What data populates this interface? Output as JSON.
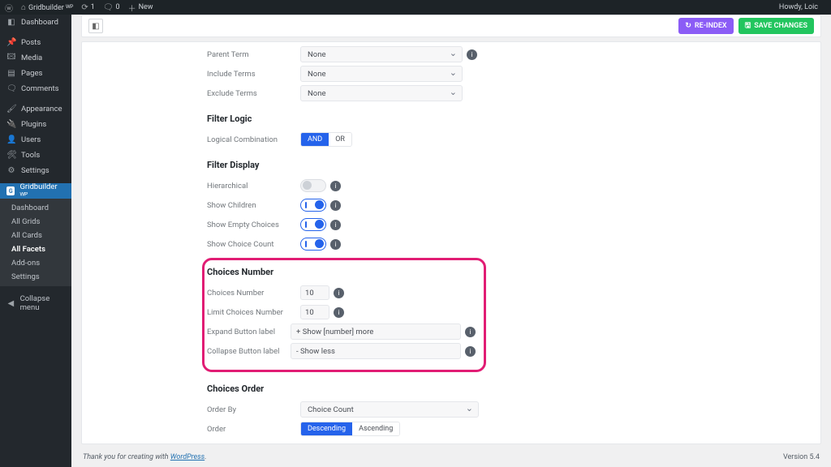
{
  "adminbar": {
    "site_name": "Gridbuilder ᵂᴾ",
    "updates": "1",
    "comments": "0",
    "new_label": "New",
    "howdy": "Howdy, Loic"
  },
  "sidebar": {
    "items": [
      {
        "icon": "◧",
        "label": "Dashboard"
      },
      {
        "icon": "✎",
        "label": "Posts"
      },
      {
        "icon": "🖾",
        "label": "Media"
      },
      {
        "icon": "▤",
        "label": "Pages"
      },
      {
        "icon": "✉",
        "label": "Comments"
      }
    ],
    "items2": [
      {
        "icon": "✦",
        "label": "Appearance"
      },
      {
        "icon": "⚙",
        "label": "Plugins"
      },
      {
        "icon": "👤",
        "label": "Users"
      },
      {
        "icon": "🛠",
        "label": "Tools"
      },
      {
        "icon": "⚙",
        "label": "Settings"
      }
    ],
    "gridbuilder": {
      "label": "Gridbuilder ᵂᴾ"
    },
    "sub": [
      "Dashboard",
      "All Grids",
      "All Cards",
      "All Facets",
      "Add-ons",
      "Settings"
    ],
    "sub_active_index": 3,
    "collapse": "Collapse menu"
  },
  "header": {
    "reindex": "RE-INDEX",
    "save": "SAVE CHANGES"
  },
  "form": {
    "parent_term": {
      "label": "Parent Term",
      "value": "None"
    },
    "include_terms": {
      "label": "Include Terms",
      "value": "None"
    },
    "exclude_terms": {
      "label": "Exclude Terms",
      "value": "None"
    },
    "filter_logic_title": "Filter Logic",
    "logical_combination": {
      "label": "Logical Combination",
      "opts": [
        "AND",
        "OR"
      ],
      "active": 0
    },
    "filter_display_title": "Filter Display",
    "hierarchical": {
      "label": "Hierarchical",
      "on": false
    },
    "show_children": {
      "label": "Show Children",
      "on": true
    },
    "show_empty": {
      "label": "Show Empty Choices",
      "on": true
    },
    "show_count": {
      "label": "Show Choice Count",
      "on": true
    },
    "choices_number_title": "Choices Number",
    "choices_number": {
      "label": "Choices Number",
      "value": "10"
    },
    "limit_choices": {
      "label": "Limit Choices Number",
      "value": "10"
    },
    "expand_label": {
      "label": "Expand Button label",
      "value": "+ Show [number] more"
    },
    "collapse_label": {
      "label": "Collapse Button label",
      "value": "- Show less"
    },
    "choices_order_title": "Choices Order",
    "order_by": {
      "label": "Order By",
      "value": "Choice Count"
    },
    "order": {
      "label": "Order",
      "opts": [
        "Descending",
        "Ascending"
      ],
      "active": 0
    }
  },
  "footer": {
    "thanks_pre": "Thank you for creating with ",
    "wp": "WordPress",
    "version": "Version 5.4"
  }
}
